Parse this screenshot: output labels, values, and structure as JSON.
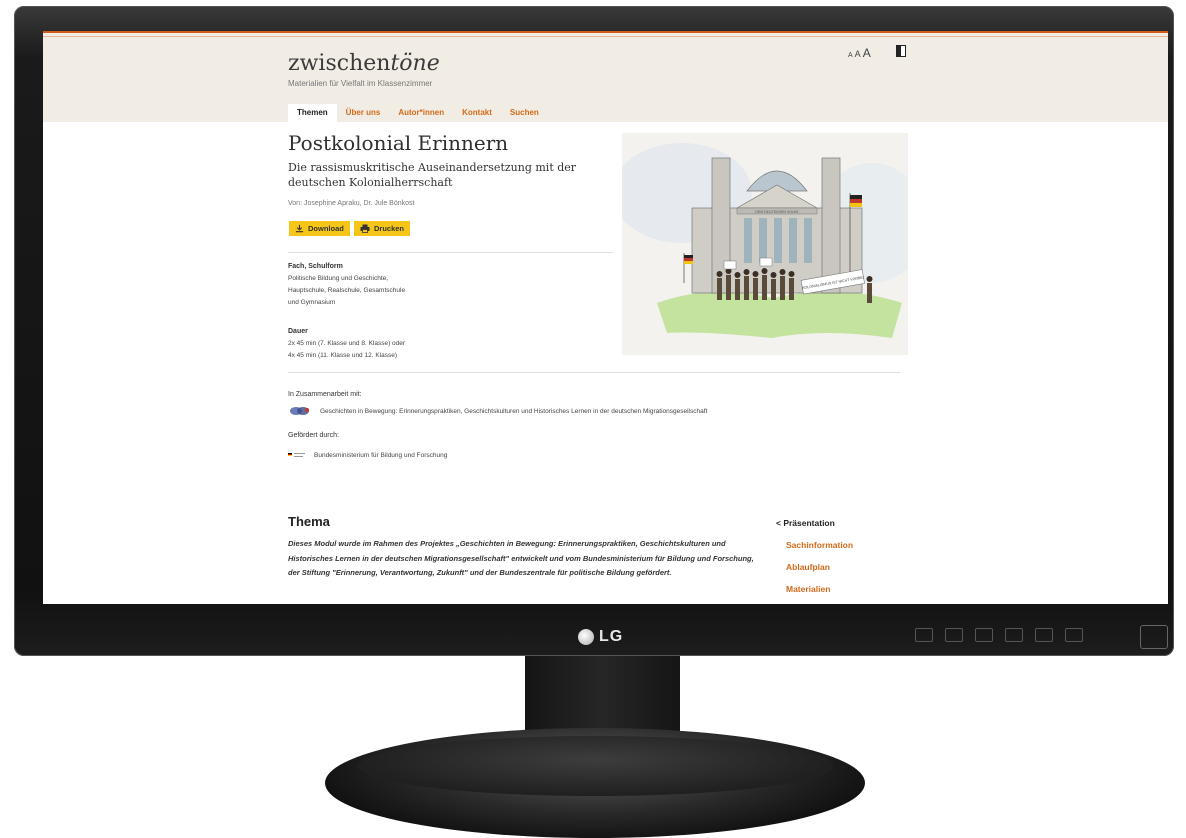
{
  "bezel": {
    "brand": "LG"
  },
  "site": {
    "logo_main": "zwischen",
    "logo_italic": "töne",
    "tagline": "Materialien für Vielfalt im Klassenzimmer",
    "text_size_labels": [
      "A",
      "A",
      "A"
    ],
    "nav": [
      {
        "label": "Themen",
        "active": true
      },
      {
        "label": "Über uns",
        "active": false
      },
      {
        "label": "Autor*innen",
        "active": false
      },
      {
        "label": "Kontakt",
        "active": false
      },
      {
        "label": "Suchen",
        "active": false
      }
    ],
    "accent_color": "#d26a1a",
    "button_color": "#f5c518"
  },
  "article": {
    "title": "Postkolonial Erinnern",
    "subtitle": "Die rassismuskritische Auseinandersetzung mit der deutschen Kolonialherrschaft",
    "authors": "Von: Josephine Apraku, Dr. Jule Bönkost",
    "download_label": "Download",
    "print_label": "Drucken",
    "fach_heading": "Fach, Schulform",
    "fach_lines": [
      "Politische Bildung und Geschichte,",
      "Hauptschule, Realschule, Gesamtschule",
      "und Gymnasium"
    ],
    "dauer_heading": "Dauer",
    "dauer_lines": [
      "2x 45 min (7. Klasse und 8. Klasse) oder",
      "4x 45 min (11. Klasse und 12. Klasse)"
    ],
    "cooperation_heading": "In Zusammenarbeit mit:",
    "cooperation_text": "Geschichten in Bewegung: Erinnerungspraktiken, Geschichtskulturen und Historisches Lernen in der deutschen Migrationsgesellschaft",
    "funded_heading": "Gefördert durch:",
    "funded_text": "Bundesministerium für Bildung und Forschung",
    "illustration_sign": "DEM DEUTSCHEN VOLKE",
    "illustration_banner": "KOLONIALISMUS IST NICHT VORBEI"
  },
  "thema": {
    "heading": "Thema",
    "text": "Dieses Modul wurde im Rahmen des Projektes „Geschichten in Bewegung: Erinnerungspraktiken, Geschichtskulturen und Historisches Lernen in der deutschen Migrationsgesellschaft\" entwickelt und vom Bundesministerium für Bildung und Forschung, der Stiftung \"Erinnerung, Verantwortung, Zukunft\" und der Bundeszentrale für politische Bildung gefördert."
  },
  "sidebar": {
    "back": "< Präsentation",
    "items": [
      "Sachinformation",
      "Ablaufplan",
      "Materialien"
    ]
  }
}
